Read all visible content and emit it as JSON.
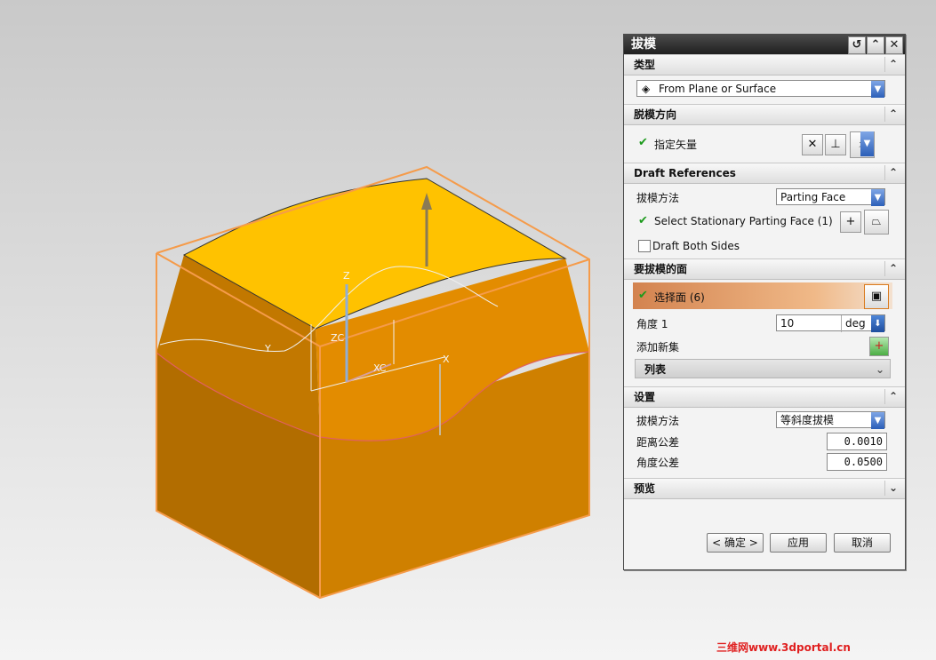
{
  "dialog": {
    "title": "拔模",
    "sections": {
      "type": {
        "header": "类型",
        "type_value": "From Plane or Surface"
      },
      "direction": {
        "header": "脱模方向",
        "specify_vector": "指定矢量"
      },
      "draft_refs": {
        "header": "Draft References",
        "method_label": "拔模方法",
        "method_value": "Parting Face",
        "select_parting": "Select Stationary Parting Face (1)",
        "draft_both_sides": "Draft Both Sides"
      },
      "faces": {
        "header": "要拔模的面",
        "select_face": "选择面 (6)",
        "angle_label": "角度 1",
        "angle_value": "10",
        "angle_unit": "deg",
        "add_new_set": "添加新集",
        "list_label": "列表"
      },
      "settings": {
        "header": "设置",
        "method_label": "拔模方法",
        "method_value": "等斜度拔模",
        "distance_tol_label": "距离公差",
        "distance_tol_value": "0.0010",
        "angle_tol_label": "角度公差",
        "angle_tol_value": "0.0500"
      },
      "preview": {
        "header": "预览"
      }
    },
    "buttons": {
      "ok": "< 确定 >",
      "apply": "应用",
      "cancel": "取消"
    }
  },
  "viewport": {
    "axis_labels": {
      "zc": "ZC",
      "xc": "XC",
      "x": "X",
      "y": "Y",
      "z": "Z"
    }
  },
  "colors": {
    "body_orange": "#d98a00",
    "top_face": "#ffc200",
    "selection_highlight": "#f59b4a"
  },
  "watermark": "三维网www.3dportal.cn"
}
